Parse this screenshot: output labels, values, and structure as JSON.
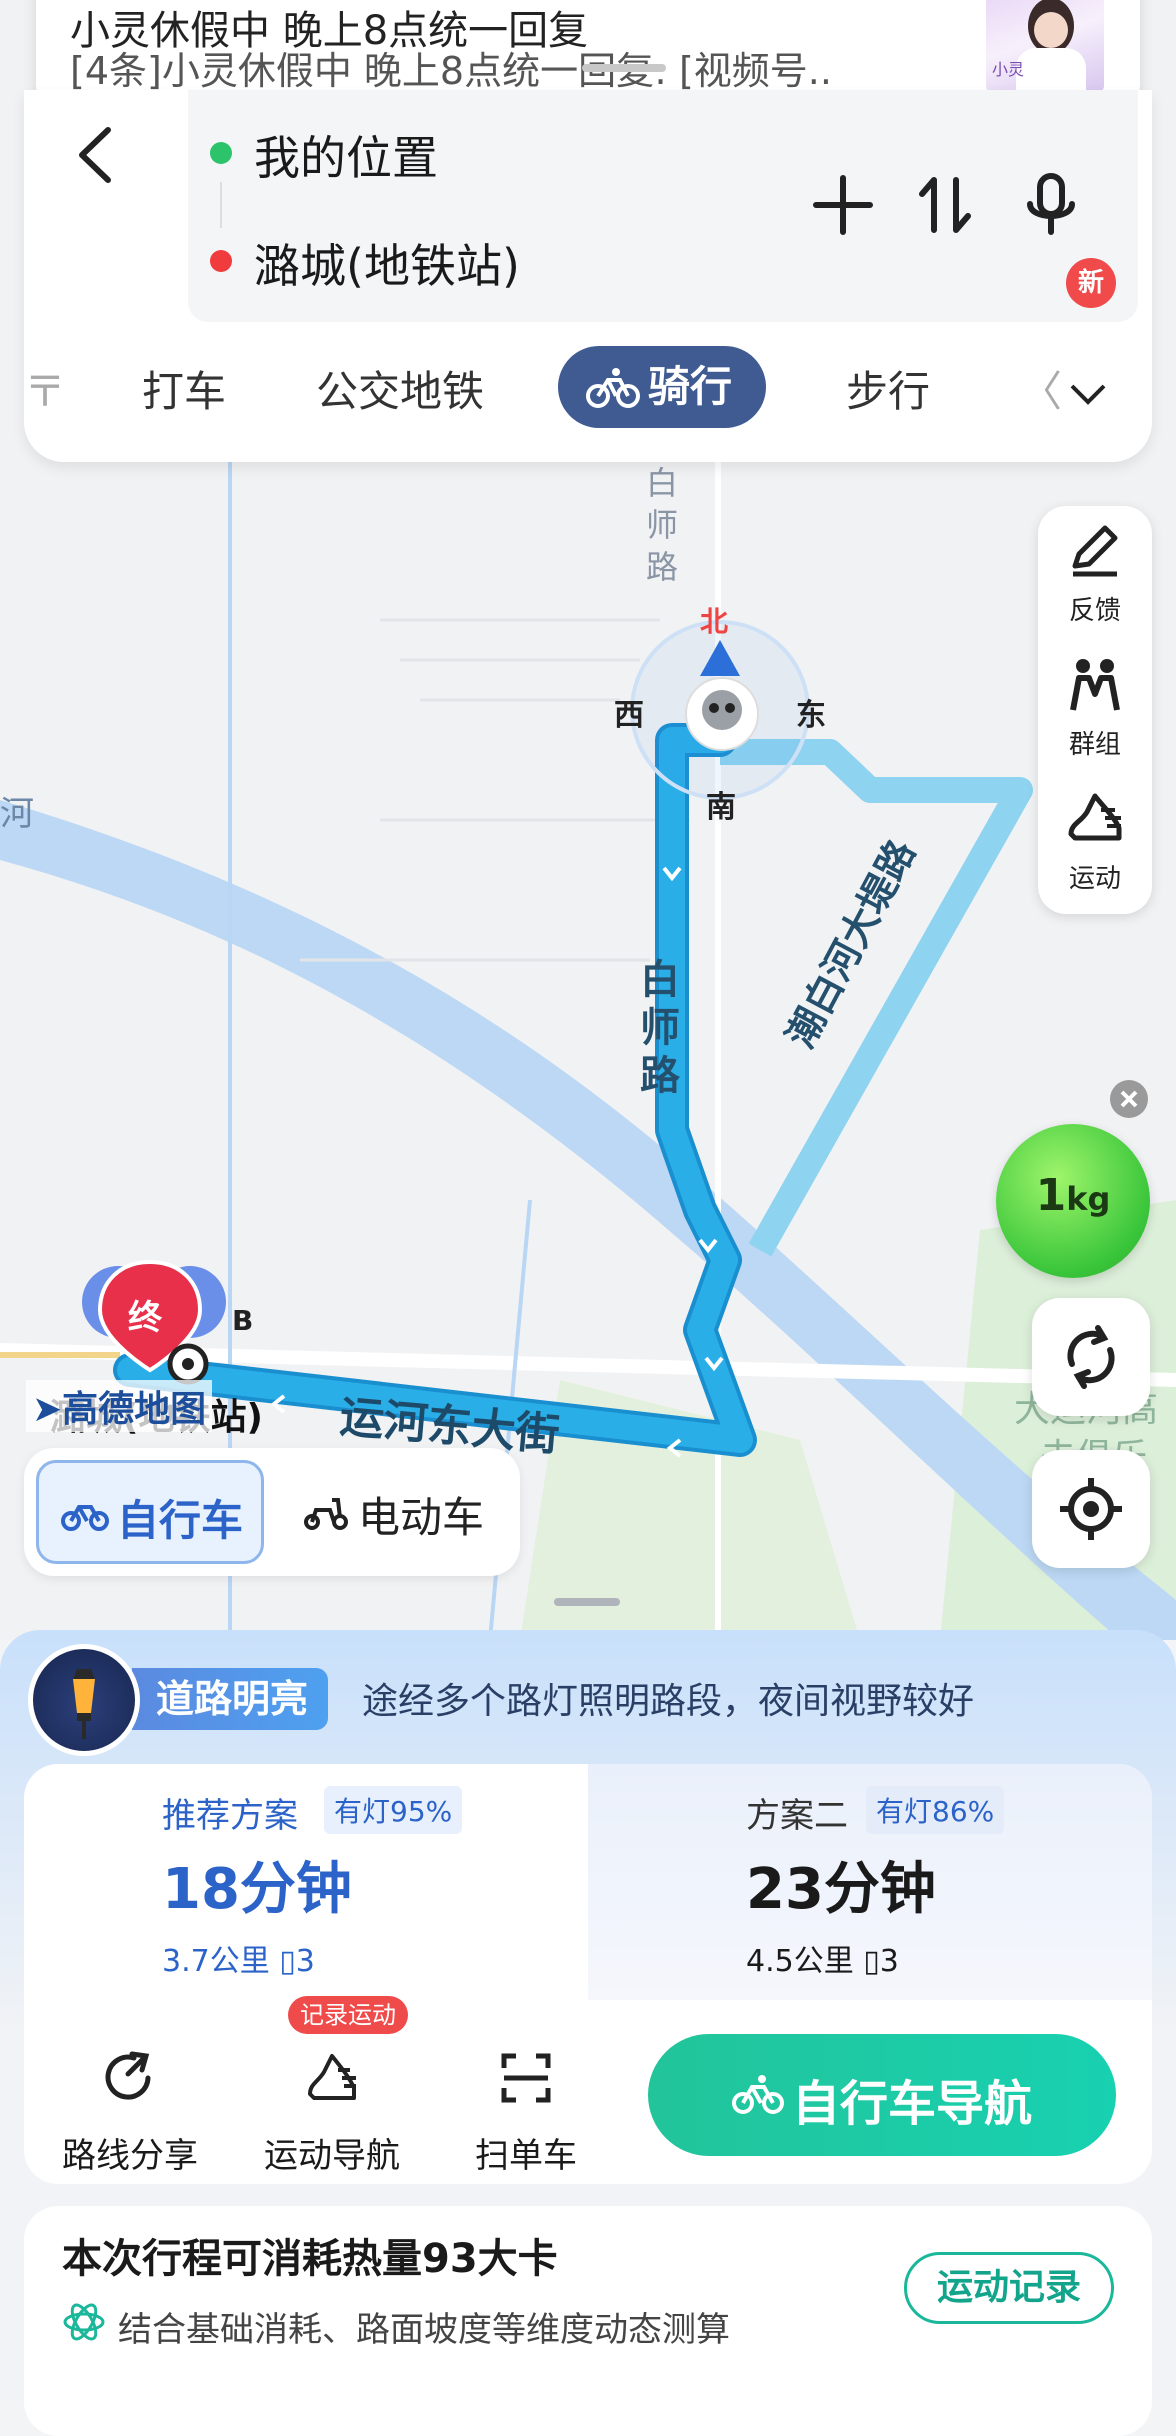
{
  "notification": {
    "title": "小灵休假中    晚上8点统一回复",
    "body": "[4条]小灵休假中    晚上8点统一回复: [视频号..",
    "thumb_text": "小灵"
  },
  "route": {
    "origin": "我的位置",
    "destination": "潞城(地铁站)",
    "origin_color": "#2cc36b",
    "destination_color": "#f03c3c"
  },
  "modes": {
    "items": [
      "打车",
      "公交地铁",
      "骑行",
      "步行"
    ],
    "active": "骑行",
    "new_badge": "新"
  },
  "map": {
    "compass": {
      "north": "北",
      "south": "南",
      "west": "西",
      "east": "东"
    },
    "roads": {
      "baishi_top": "白师路",
      "baishi_route": "白师路",
      "chaobai": "潮白河大堤路",
      "yunhe": "运河东大街",
      "river": "河"
    },
    "poi_b": "B",
    "end_marker": "终",
    "dest_label": "潞城(地铁站)",
    "logo": "高德地图",
    "right_poi": "大运河高",
    "right_poi2": "夫俱乐"
  },
  "tools": {
    "feedback": "反馈",
    "group": "群组",
    "sport": "运动"
  },
  "carbon": {
    "value": "1",
    "unit": "kg"
  },
  "vehicle": {
    "bike": "自行车",
    "ebike": "电动车"
  },
  "lamp": {
    "tag": "道路明亮",
    "desc": "途经多个路灯照明路段，夜间视野较好"
  },
  "plans": [
    {
      "title": "推荐方案",
      "badge": "有灯95%",
      "time": "18分钟",
      "distance": "3.7公里",
      "lights": "3"
    },
    {
      "title": "方案二",
      "badge": "有灯86%",
      "time": "23分钟",
      "distance": "4.5公里",
      "lights": "3"
    }
  ],
  "actions": {
    "share": "路线分享",
    "sport_nav": "运动导航",
    "scan": "扫单车",
    "record_badge": "记录运动"
  },
  "nav_button": "自行车导航",
  "calories": {
    "title": "本次行程可消耗热量93大卡",
    "desc": "结合基础消耗、路面坡度等维度动态测算",
    "button": "运动记录"
  },
  "colors": {
    "route": "#29aee8",
    "alt_route": "#8ed3f0",
    "accent": "#3f5b92",
    "nav_green": "#1fc9a5",
    "plan_blue": "#2b63c9"
  }
}
